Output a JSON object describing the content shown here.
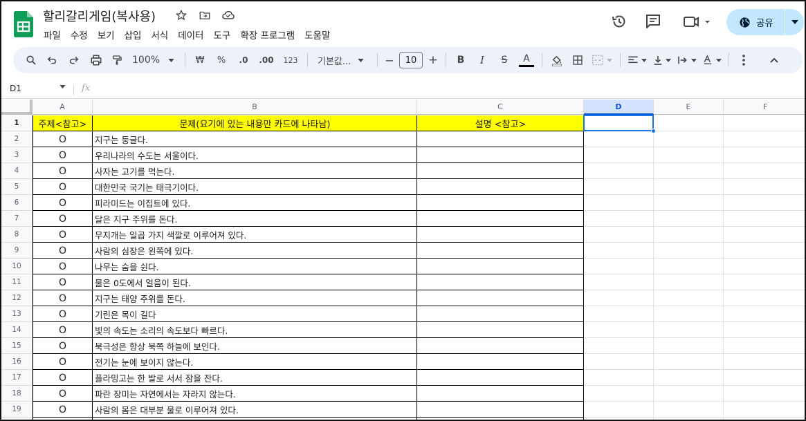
{
  "app": {
    "doc_title": "할리갈리게임(복사용)",
    "brand_color": "#0f9d58",
    "icons": [
      "star-icon",
      "move-to-folder-icon",
      "cloud-status-icon"
    ]
  },
  "menu": [
    "파일",
    "수정",
    "보기",
    "삽입",
    "서식",
    "데이터",
    "도구",
    "확장 프로그램",
    "도움말"
  ],
  "top_right": {
    "history_icon": "history-icon",
    "comments_icon": "comments-icon",
    "meet_icon": "video-call-icon",
    "share_label": "공유",
    "share_color": "#c2e7ff"
  },
  "toolbar": {
    "zoom": "100%",
    "currency": "₩",
    "percent": "%",
    "dec_decrease": ".0",
    "dec_increase": ".00",
    "number_format": "123",
    "font": "기본값...",
    "font_size": "10",
    "minus": "−",
    "plus": "+",
    "bold": "B",
    "italic": "I",
    "strike": "S",
    "text_color": "A",
    "text_color_swatch": "#000000"
  },
  "formula_bar": {
    "name_box": "D1",
    "fx": "fx",
    "value": ""
  },
  "columns": [
    "A",
    "B",
    "C",
    "D",
    "E",
    "F"
  ],
  "selected_column": "D",
  "rows": [
    {
      "n": "1",
      "a": "주제<참고>",
      "b": "문제(요기에 있는 내용만 카드에 나타남)",
      "c": "설명 <참고>"
    },
    {
      "n": "2",
      "a": "O",
      "b": "지구는 둥글다.",
      "c": ""
    },
    {
      "n": "3",
      "a": "O",
      "b": "우리나라의 수도는 서울이다.",
      "c": ""
    },
    {
      "n": "4",
      "a": "O",
      "b": "사자는 고기를 먹는다.",
      "c": ""
    },
    {
      "n": "5",
      "a": "O",
      "b": "대한민국 국기는 태극기이다.",
      "c": ""
    },
    {
      "n": "6",
      "a": "O",
      "b": "피라미드는 이집트에 있다.",
      "c": ""
    },
    {
      "n": "7",
      "a": "O",
      "b": "달은 지구 주위를 돈다.",
      "c": ""
    },
    {
      "n": "8",
      "a": "O",
      "b": "무지개는 일곱 가지 색깔로 이루어져 있다.",
      "c": ""
    },
    {
      "n": "9",
      "a": "O",
      "b": "사람의 심장은 왼쪽에 있다.",
      "c": ""
    },
    {
      "n": "10",
      "a": "O",
      "b": "나무는 숨을 쉰다.",
      "c": ""
    },
    {
      "n": "11",
      "a": "O",
      "b": "물은 0도에서 얼음이 된다.",
      "c": ""
    },
    {
      "n": "12",
      "a": "O",
      "b": "지구는 태양 주위를 돈다.",
      "c": ""
    },
    {
      "n": "13",
      "a": "O",
      "b": "기린은 목이 길다",
      "c": ""
    },
    {
      "n": "14",
      "a": "O",
      "b": "빛의 속도는 소리의 속도보다 빠르다.",
      "c": ""
    },
    {
      "n": "15",
      "a": "O",
      "b": "북극성은 항상 북쪽 하늘에 보인다.",
      "c": ""
    },
    {
      "n": "16",
      "a": "O",
      "b": "전기는 눈에 보이지 않는다.",
      "c": ""
    },
    {
      "n": "17",
      "a": "O",
      "b": "플라밍고는 한 발로 서서 잠을 잔다.",
      "c": ""
    },
    {
      "n": "18",
      "a": "O",
      "b": "파란 장미는 자연에서는 자라지 않는다.",
      "c": ""
    },
    {
      "n": "19",
      "a": "O",
      "b": "사람의 몸은 대부분 물로 이루어져 있다.",
      "c": ""
    }
  ],
  "colors": {
    "header_fill": "#ffff00",
    "selection": "#1a73e8",
    "toolbar_bg": "#edf2fa"
  }
}
